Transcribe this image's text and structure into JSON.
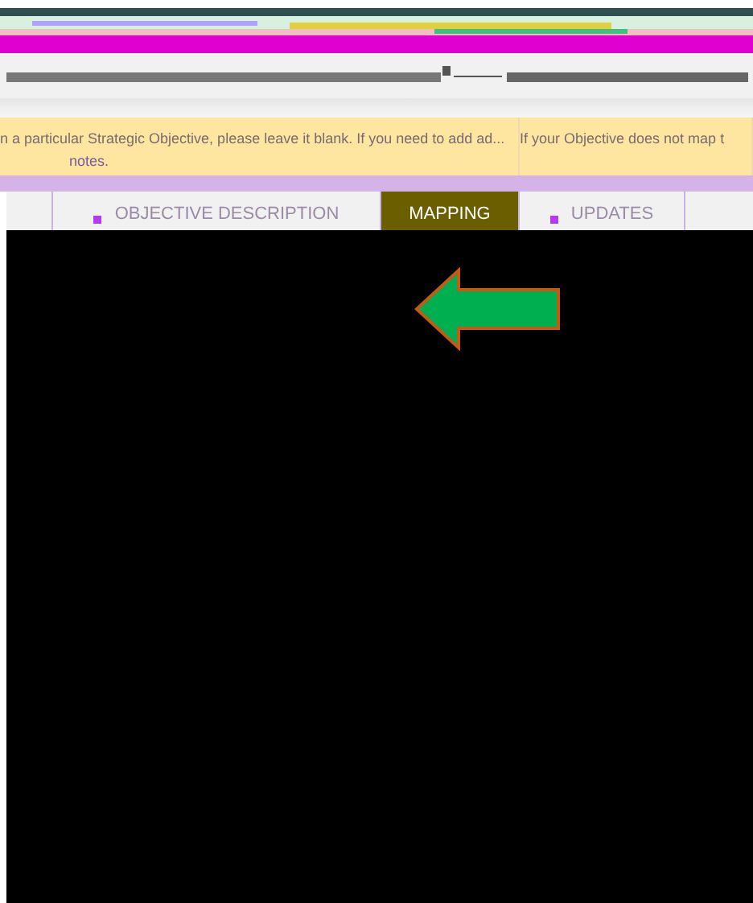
{
  "notice": {
    "lines": [
      {
        "text": "n a particular Strategic Objective, please leave it blank. If you need to add ad..."
      },
      {
        "text": "If your Objective does not map t"
      }
    ],
    "footer": "notes."
  },
  "tabs": [
    {
      "label": "OBJECTIVE DESCRIPTION",
      "selected": false
    },
    {
      "label": "MAPPING",
      "selected": true
    },
    {
      "label": "UPDATES",
      "selected": false
    }
  ]
}
